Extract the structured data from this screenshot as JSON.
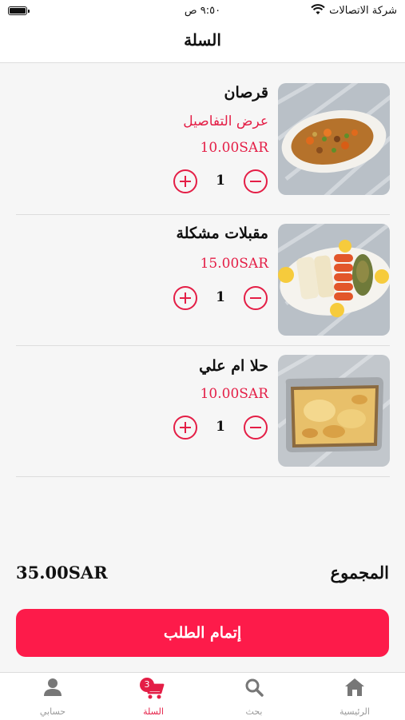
{
  "status_bar": {
    "time": "٩:٥٠ ص",
    "carrier": "شركة الاتصالات",
    "wifi_icon": "wifi-icon",
    "battery_icon": "battery-icon"
  },
  "header": {
    "title": "السلة"
  },
  "cart": {
    "items": [
      {
        "name": "قرصان",
        "details_link": "عرض التفاصيل",
        "price": "10.00SAR",
        "quantity": "1",
        "image": "qursan-stew-photo"
      },
      {
        "name": "مقبلات مشكلة",
        "details_link": "",
        "price": "15.00SAR",
        "quantity": "1",
        "image": "mixed-appetizers-photo"
      },
      {
        "name": "حلا ام علي",
        "details_link": "",
        "price": "10.00SAR",
        "quantity": "1",
        "image": "umm-ali-dessert-photo"
      }
    ]
  },
  "summary": {
    "total_label": "المجموع",
    "total_value": "35.00SAR"
  },
  "checkout": {
    "label": "إتمام الطلب"
  },
  "tab_bar": {
    "tabs": [
      {
        "label": "الرئيسية",
        "icon": "home-icon",
        "active": false
      },
      {
        "label": "بحث",
        "icon": "search-icon",
        "active": false
      },
      {
        "label": "السلة",
        "icon": "cart-icon",
        "active": true,
        "badge": "3"
      },
      {
        "label": "حسابي",
        "icon": "person-icon",
        "active": false
      }
    ]
  },
  "colors": {
    "accent": "#e41e46",
    "button": "#fd1b4a",
    "background": "#f6f6f6"
  }
}
